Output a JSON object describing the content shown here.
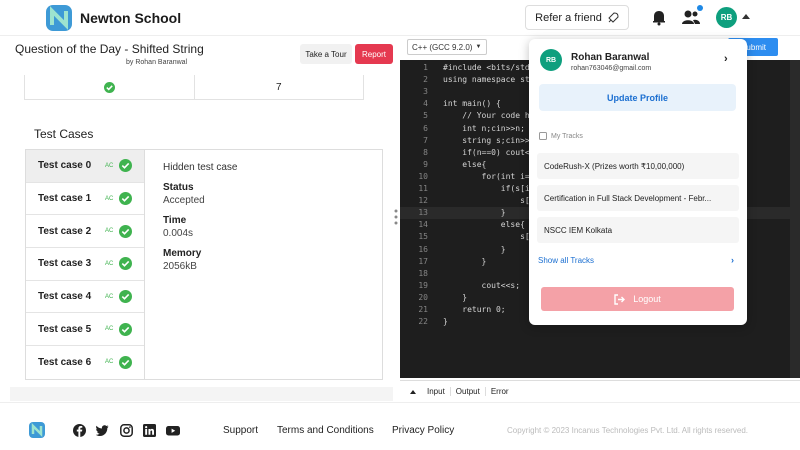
{
  "header": {
    "brand": "Newton School",
    "refer_label": "Refer a friend",
    "avatar_initials": "RB"
  },
  "question": {
    "title": "Question of the Day - Shifted String",
    "author": "by Rohan Baranwal",
    "tour_label": "Take a Tour",
    "report_label": "Report"
  },
  "summary": {
    "count": "7"
  },
  "test_cases": {
    "heading": "Test Cases",
    "items": [
      {
        "label": "Test case 0",
        "badge": "AC"
      },
      {
        "label": "Test case 1",
        "badge": "AC"
      },
      {
        "label": "Test case 2",
        "badge": "AC"
      },
      {
        "label": "Test case 3",
        "badge": "AC"
      },
      {
        "label": "Test case 4",
        "badge": "AC"
      },
      {
        "label": "Test case 5",
        "badge": "AC"
      },
      {
        "label": "Test case 6",
        "badge": "AC"
      }
    ],
    "detail": {
      "hidden": "Hidden test case",
      "status_label": "Status",
      "status_value": "Accepted",
      "time_label": "Time",
      "time_value": "0.004s",
      "memory_label": "Memory",
      "memory_value": "2056kB"
    }
  },
  "editor": {
    "language": "C++ (GCC 9.2.0)",
    "submit_label": "Submit",
    "highlight_line": 13,
    "lines": [
      {
        "n": "1",
        "code": "#include <bits/std"
      },
      {
        "n": "2",
        "code": "using namespace st"
      },
      {
        "n": "3",
        "code": ""
      },
      {
        "n": "4",
        "code": "int main() {"
      },
      {
        "n": "5",
        "code": "    // Your code h"
      },
      {
        "n": "6",
        "code": "    int n;cin>>n;"
      },
      {
        "n": "7",
        "code": "    string s;cin>>"
      },
      {
        "n": "8",
        "code": "    if(n==0) cout<"
      },
      {
        "n": "9",
        "code": "    else{"
      },
      {
        "n": "10",
        "code": "        for(int i="
      },
      {
        "n": "11",
        "code": "            if(s[i"
      },
      {
        "n": "12",
        "code": "                s["
      },
      {
        "n": "13",
        "code": "            }"
      },
      {
        "n": "14",
        "code": "            else{"
      },
      {
        "n": "15",
        "code": "                s["
      },
      {
        "n": "16",
        "code": "            }"
      },
      {
        "n": "17",
        "code": "        }"
      },
      {
        "n": "18",
        "code": ""
      },
      {
        "n": "19",
        "code": "        cout<<s;"
      },
      {
        "n": "20",
        "code": "    }"
      },
      {
        "n": "21",
        "code": "    return 0;"
      },
      {
        "n": "22",
        "code": "}"
      }
    ],
    "console_tabs": [
      "Input",
      "Output",
      "Error"
    ]
  },
  "dropdown": {
    "initials": "RB",
    "name": "Rohan Baranwal",
    "email": "rohan763046@gmail.com",
    "update_label": "Update Profile",
    "tracks_label": "My Tracks",
    "tracks": [
      "CodeRush-X (Prizes worth ₹10,00,000)",
      "Certification in Full Stack Development - Febr...",
      "NSCC IEM Kolkata"
    ],
    "show_all_label": "Show all Tracks",
    "logout_label": "Logout"
  },
  "footer": {
    "links": [
      "Support",
      "Terms and Conditions",
      "Privacy Policy"
    ],
    "copyright": "Copyright © 2023 Incanus Technologies Pvt. Ltd. All rights reserved."
  },
  "colors": {
    "brand_teal": "#0e9f7e",
    "accent_blue": "#1b6fd1",
    "success_green": "#3fb34f",
    "report_red": "#e53950",
    "logout_pink": "#f4a1a7"
  },
  "icons": [
    "logo-icon",
    "rocket-icon",
    "bell-icon",
    "people-icon",
    "check-icon",
    "chevron-right-icon",
    "logout-icon",
    "facebook-icon",
    "twitter-icon",
    "instagram-icon",
    "linkedin-icon",
    "youtube-icon"
  ]
}
